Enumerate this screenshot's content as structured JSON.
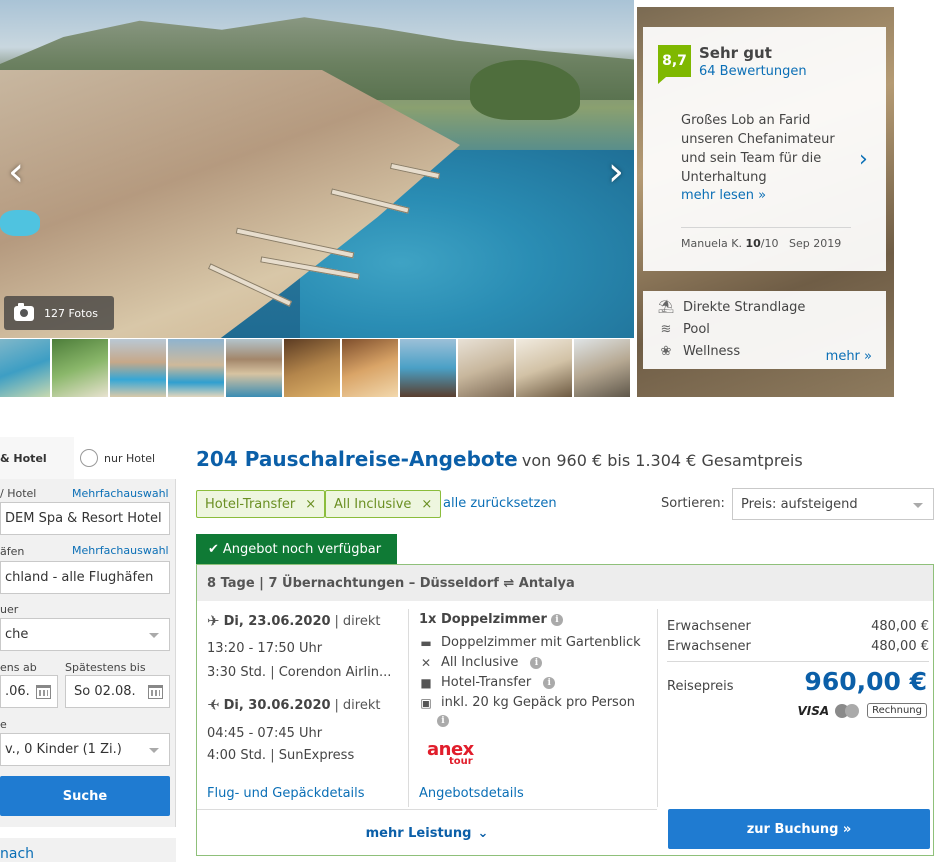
{
  "gallery": {
    "photos_label": "127 Fotos",
    "prev_icon": "chevron-left-icon",
    "next_icon": "chevron-right-icon"
  },
  "review": {
    "score": "8,7",
    "rating_word": "Sehr gut",
    "count": "64 Bewertungen",
    "quote": "Großes Lob an Farid unseren Chefanimateur und sein Team für die Unterhaltung",
    "read_more": "mehr lesen »",
    "author": "Manuela K.",
    "author_score": "10",
    "author_score_max": "/10",
    "date": "Sep 2019"
  },
  "features": {
    "items": [
      {
        "label": "Direkte Strandlage",
        "icon": "beach-icon"
      },
      {
        "label": "Pool",
        "icon": "pool-icon"
      },
      {
        "label": "Wellness",
        "icon": "lotus-icon"
      }
    ],
    "more": "mehr »"
  },
  "search": {
    "tab_package": "& Hotel",
    "tab_hotel_only": "nur Hotel",
    "hotel_label": "/ Hotel",
    "multi_select": "Mehrfachauswahl",
    "hotel_value": "DEM Spa & Resort Hotel",
    "airport_label": "äfen",
    "airport_multi": "Mehrfachauswahl",
    "airport_value": "chland - alle Flughäfen",
    "duration_label": "uer",
    "duration_value": "che",
    "earliest_label": "ens ab",
    "earliest_value": ".06.",
    "latest_label": "Spätestens bis",
    "latest_value": "So 02.08.",
    "travelers_label": "e",
    "travelers_value": "v., 0 Kinder (1 Zi.)",
    "button": "Suche",
    "bottom_link": "nach"
  },
  "results": {
    "count_title": "204 Pauschalreise-Angebote",
    "price_range": "von 960 € bis 1.304 € Gesamtpreis",
    "filters": [
      "Hotel-Transfer",
      "All Inclusive"
    ],
    "reset": "alle zurücksetzen",
    "sort_label": "Sortieren:",
    "sort_value": "Preis: aufsteigend"
  },
  "offer": {
    "availability": "Angebot noch verfügbar",
    "header": "8 Tage | 7 Übernachtungen – Düsseldorf ⇌ Antalya",
    "outbound": {
      "date": "Di, 23.06.2020",
      "type": "direkt",
      "time": "13:20 - 17:50 Uhr",
      "duration": "3:30 Std.",
      "airline": "Corendon Airlin..."
    },
    "return": {
      "date": "Di, 30.06.2020",
      "type": "direkt",
      "time": "04:45 - 07:45 Uhr",
      "duration": "4:00 Std.",
      "airline": "SunExpress"
    },
    "flight_details": "Flug- und Gepäckdetails",
    "room_title": "1x Doppelzimmer",
    "amenities": [
      {
        "label": "Doppelzimmer mit Gartenblick",
        "icon": "bed-icon"
      },
      {
        "label": "All Inclusive",
        "icon": "cutlery-icon"
      },
      {
        "label": "Hotel-Transfer",
        "icon": "bus-icon"
      },
      {
        "label": "inkl. 20 kg Gepäck pro Person",
        "icon": "luggage-icon"
      }
    ],
    "operator_top": "anex",
    "operator_bottom": "tour",
    "offer_details": "Angebotsdetails",
    "more_services": "mehr Leistung",
    "price_rows": [
      {
        "label": "Erwachsener",
        "value": "480,00 €"
      },
      {
        "label": "Erwachsener",
        "value": "480,00 €"
      }
    ],
    "total_label": "Reisepreis",
    "total": "960,00 €",
    "pay_visa": "VISA",
    "pay_invoice": "Rechnung",
    "book": "zur Buchung »"
  }
}
